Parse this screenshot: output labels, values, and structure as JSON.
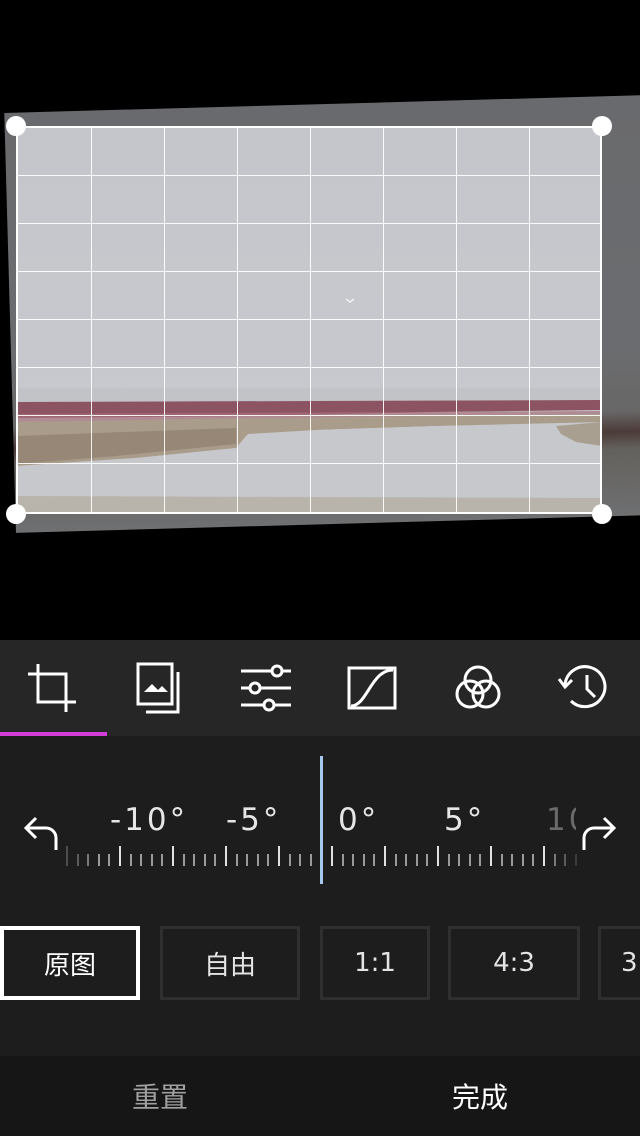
{
  "editor": {
    "tools": [
      {
        "name": "crop",
        "icon": "crop-icon",
        "active": true
      },
      {
        "name": "image",
        "icon": "image-layers-icon",
        "active": false
      },
      {
        "name": "adjust",
        "icon": "sliders-icon",
        "active": false
      },
      {
        "name": "curves",
        "icon": "curve-icon",
        "active": false
      },
      {
        "name": "color",
        "icon": "color-circles-icon",
        "active": false
      },
      {
        "name": "history",
        "icon": "history-icon",
        "active": false
      }
    ],
    "accent_color": "#d33fd6",
    "needle_color": "#a5c9ec"
  },
  "rotation": {
    "labels": [
      "-10°",
      "-5°",
      "0°",
      "5°",
      "10°"
    ],
    "current_value": "0°",
    "rotate_left_icon": "rotate-left-icon",
    "rotate_right_icon": "rotate-right-icon"
  },
  "ratios": {
    "options": [
      "原图",
      "自由",
      "1:1",
      "4:3",
      "3"
    ],
    "selected": "原图"
  },
  "actions": {
    "reset_label": "重置",
    "done_label": "完成"
  }
}
